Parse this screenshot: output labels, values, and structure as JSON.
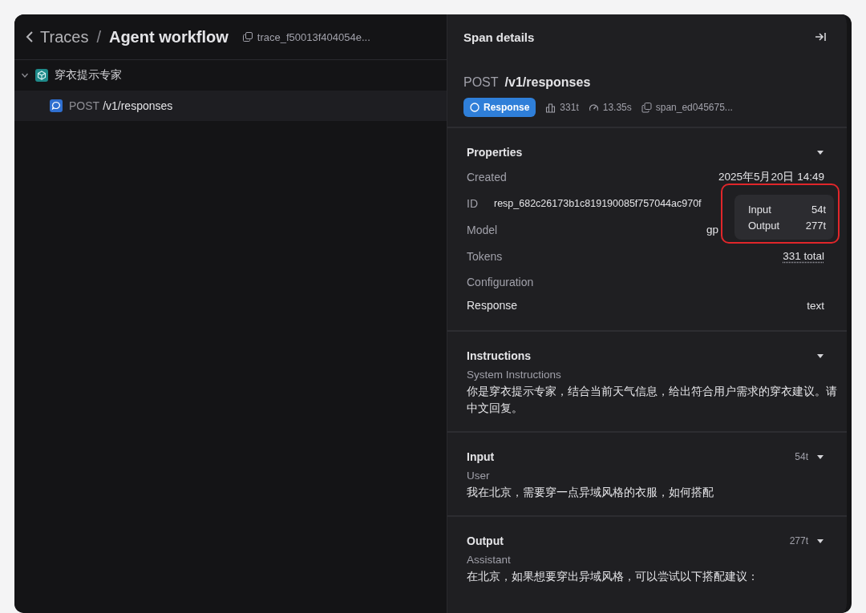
{
  "breadcrumb": {
    "back": "Traces",
    "separator": "/",
    "title": "Agent workflow",
    "trace_id": "trace_f50013f404054e..."
  },
  "tree": [
    {
      "label": "穿衣提示专家",
      "kind": "agent",
      "expanded": true,
      "selected": false,
      "children": [
        {
          "method": "POST",
          "label": "/v1/responses",
          "kind": "response",
          "selected": true
        }
      ]
    }
  ],
  "panel": {
    "title": "Span details",
    "method": "POST",
    "path": "/v1/responses",
    "badge": "Response",
    "tokens": "331t",
    "duration": "13.35s",
    "span_id": "span_ed045675..."
  },
  "properties": {
    "title": "Properties",
    "expanded": true,
    "rows": [
      {
        "label": "Created",
        "value": "2025年5月20日 14:49",
        "kind": "text"
      },
      {
        "label": "ID",
        "value": "resp_682c26173b1c819190085f757044ac970f",
        "kind": "id"
      },
      {
        "label": "Model",
        "value": "gp",
        "kind": "covered"
      },
      {
        "label": "Tokens",
        "value": "331 total",
        "kind": "dotted"
      }
    ],
    "configuration": {
      "title": "Configuration",
      "rows": [
        {
          "label": "Response",
          "value": "text",
          "kind": "strong"
        }
      ]
    }
  },
  "tooltip": {
    "rows": [
      {
        "label": "Input",
        "value": "54t"
      },
      {
        "label": "Output",
        "value": "277t"
      }
    ]
  },
  "sections": [
    {
      "title": "Instructions",
      "expanded": true,
      "role": "System Instructions",
      "text": "你是穿衣提示专家，结合当前天气信息，给出符合用户需求的穿衣建议。请中文回复。"
    },
    {
      "title": "Input",
      "count": "54t",
      "expanded": true,
      "role": "User",
      "text": "我在北京，需要穿一点异域风格的衣服，如何搭配"
    },
    {
      "title": "Output",
      "count": "277t",
      "expanded": true,
      "role": "Assistant",
      "text": "在北京，如果想要穿出异域风格，可以尝试以下搭配建议："
    }
  ]
}
